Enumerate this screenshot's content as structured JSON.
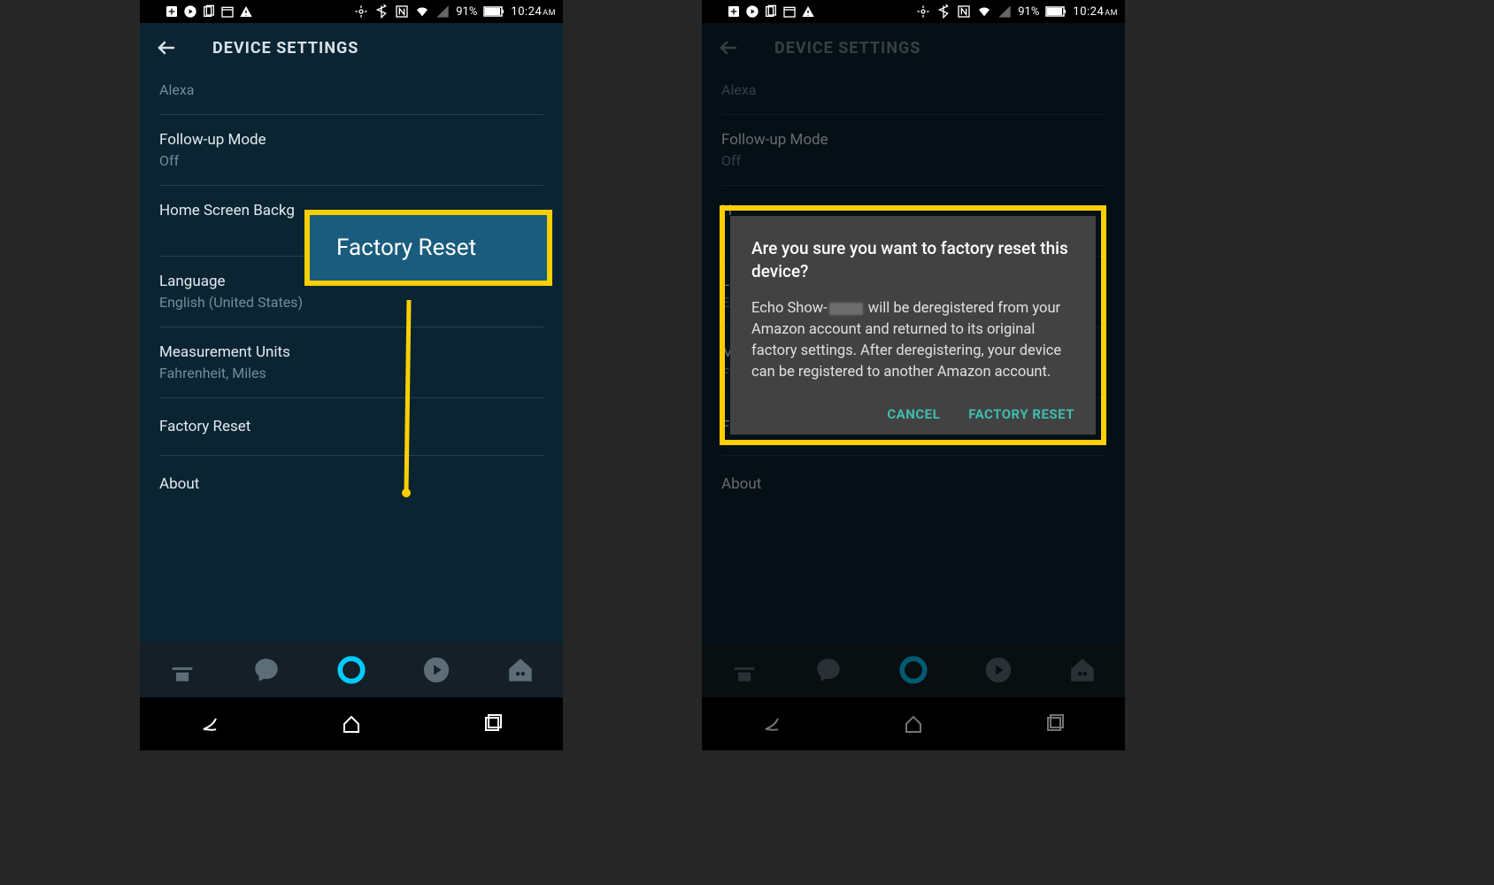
{
  "status": {
    "battery": "91%",
    "time": "10:24",
    "ampm": "AM"
  },
  "header": {
    "title": "DEVICE SETTINGS"
  },
  "settings": {
    "alexa": "Alexa",
    "followup_label": "Follow-up Mode",
    "followup_value": "Off",
    "homescreen_label": "Home Screen Backg",
    "language_label": "Language",
    "language_value": "English (United States)",
    "units_label": "Measurement Units",
    "units_value": "Fahrenheit, Miles",
    "factory_reset": "Factory Reset",
    "about": "About"
  },
  "right_settings": {
    "homescreen_trunc": "H",
    "lang_trunc": "L",
    "lang_val_trunc": "E",
    "units_trunc": "M",
    "units_val_trunc": "F",
    "factory_trunc": "F"
  },
  "callout": {
    "label": "Factory Reset"
  },
  "dialog": {
    "title": "Are you sure you want to factory reset this device?",
    "body_prefix": "Echo Show-",
    "body_suffix": " will be deregistered from your Amazon account and returned to its original factory settings. After deregistering, your device can be registered to another Amazon account.",
    "cancel": "CANCEL",
    "confirm": "FACTORY RESET"
  }
}
